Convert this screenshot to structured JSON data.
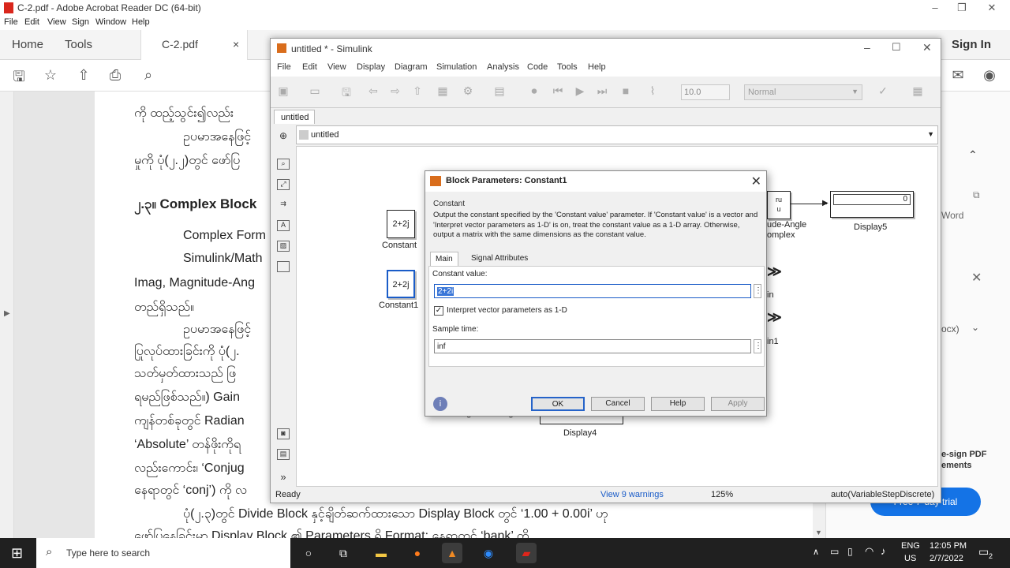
{
  "acrobat": {
    "title": "C-2.pdf - Adobe Acrobat Reader DC (64-bit)",
    "menu": [
      "File",
      "Edit",
      "View",
      "Sign",
      "Window",
      "Help"
    ],
    "tabs": {
      "home": "Home",
      "tools": "Tools",
      "doc": "C-2.pdf",
      "close": "×"
    },
    "sign_in": "Sign In",
    "right_pane": {
      "word": "Word",
      "ocx": "ocx)",
      "promo_line1": "e-sign PDF",
      "promo_line2": "ements",
      "trial_btn": "Free 7-day trial"
    }
  },
  "document": {
    "lines": [
      "ကို ထည့်သွင်း၍လည်း",
      "ဥပမာအနေဖြင့်",
      "မှုကို ပုံ(၂.၂)တွင် ဖော်ပြ",
      "၂.၃။ Complex Block",
      "Complex Form",
      "Simulink/Math",
      "Imag, Magnitude-Ang",
      "တည်ရှိသည်။",
      "ဥပမာအနေဖြင့်",
      "ပြုလုပ်ထားခြင်းကို ပုံ(၂.",
      "သတ်မှတ်ထားသည်  ဖြ",
      "ရမည်ဖြစ်သည်။)  Gain",
      "ကျန်တစ်ခုတွင်  Radian",
      "‘Absolute’  တန်ဖိုးကိုရ",
      "လည်းကောင်း၊  ‘Conjug",
      "နေရာတွင် ‘conj’) ကို လ",
      "ပုံ(၂.၃)တွင် Divide Block နှင့်ချိတ်ဆက်ထားသော Display Block တွင် ‘1.00 + 0.00i’ ဟု",
      "ဖော်ပြနေခြင်းမှာ  Display  Block  ၏  Parameters  ရှိ  Format:  နေရာတွင်  ‘bank’  ကို"
    ]
  },
  "simulink": {
    "title": "untitled * - Simulink",
    "menu": [
      "File",
      "Edit",
      "View",
      "Display",
      "Diagram",
      "Simulation",
      "Analysis",
      "Code",
      "Tools",
      "Help"
    ],
    "stop_time": "10.0",
    "mode": "Normal",
    "tab": "untitled",
    "address": "untitled",
    "blocks": {
      "constant": {
        "value": "2+2j",
        "label": "Constant"
      },
      "constant1": {
        "value": "2+2j",
        "label": "Constant1"
      },
      "display5": {
        "value": "0",
        "label": "Display5"
      },
      "display4": {
        "label": "Display4"
      },
      "mag_angle_a": "ude-Angle",
      "mag_angle_b": "omplex",
      "mag_angle_partial": "Magnitude-Angle",
      "in_a": "in",
      "in_b": "in1",
      "ru_a": "ru",
      "ru_b": "u"
    },
    "status": {
      "ready": "Ready",
      "warnings": "View 9 warnings",
      "zoom": "125%",
      "solver": "auto(VariableStepDiscrete)"
    }
  },
  "dialog": {
    "title": "Block Parameters: Constant1",
    "group": "Constant",
    "description": "Output the constant specified by the 'Constant value' parameter. If 'Constant value' is a vector and 'Interpret vector parameters as 1-D' is on, treat the constant value as a 1-D array. Otherwise, output a matrix with the same dimensions as the constant value.",
    "tabs": [
      "Main",
      "Signal Attributes"
    ],
    "constant_value_label": "Constant value:",
    "constant_value": "2+2i",
    "interpret_label": "Interpret vector parameters as 1-D",
    "interpret_checked": true,
    "sample_time_label": "Sample time:",
    "sample_time": "inf",
    "buttons": {
      "ok": "OK",
      "cancel": "Cancel",
      "help": "Help",
      "apply": "Apply"
    },
    "dots": "⋮"
  },
  "taskbar": {
    "search_placeholder": "Type here to search",
    "lang": "ENG",
    "region": "US",
    "time": "12:05 PM",
    "date": "2/7/2022",
    "notif_count": "2"
  }
}
